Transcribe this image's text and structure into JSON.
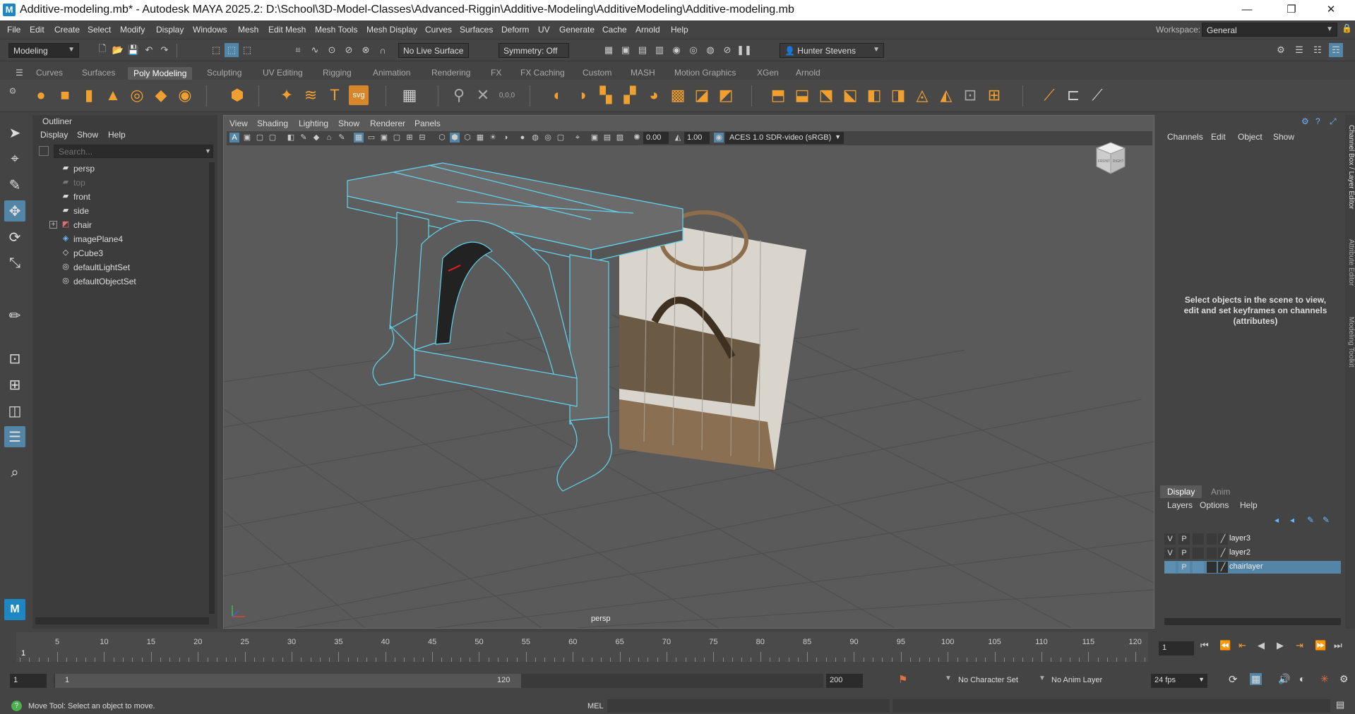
{
  "title": "Additive-modeling.mb* - Autodesk MAYA 2025.2: D:\\School\\3D-Model-Classes\\Advanced-Riggin\\Additive-Modeling\\AdditiveModeling\\Additive-modeling.mb",
  "window_controls": {
    "minimize": "—",
    "restore": "❐",
    "close": "✕"
  },
  "menubar": {
    "items": [
      "File",
      "Edit",
      "Create",
      "Select",
      "Modify",
      "Display",
      "Windows",
      "Mesh",
      "Edit Mesh",
      "Mesh Tools",
      "Mesh Display",
      "Curves",
      "Surfaces",
      "Deform",
      "UV",
      "Generate",
      "Cache",
      "Arnold",
      "Help"
    ],
    "workspace_label": "Workspace:",
    "workspace_value": "General"
  },
  "statusline": {
    "menuset": "Modeling",
    "live_surface": "No Live Surface",
    "symmetry": "Symmetry: Off",
    "user": "Hunter Stevens"
  },
  "shelf": {
    "tabs": [
      "Curves",
      "Surfaces",
      "Poly Modeling",
      "Sculpting",
      "UV Editing",
      "Rigging",
      "Animation",
      "Rendering",
      "FX",
      "FX Caching",
      "Custom",
      "MASH",
      "Motion Graphics",
      "XGen",
      "Arnold"
    ],
    "active_tab": "Poly Modeling",
    "text_icon": "T",
    "svg_icon": "svg",
    "xyz_icon": "0,0,0"
  },
  "outliner": {
    "title": "Outliner",
    "menu": [
      "Display",
      "Show",
      "Help"
    ],
    "search_placeholder": "Search...",
    "items": [
      {
        "label": "persp",
        "icon": "camera-icon"
      },
      {
        "label": "top",
        "icon": "camera-icon",
        "dimmed": true
      },
      {
        "label": "front",
        "icon": "camera-icon"
      },
      {
        "label": "side",
        "icon": "camera-icon"
      },
      {
        "label": "chair",
        "icon": "group-icon"
      },
      {
        "label": "imagePlane4",
        "icon": "image-plane-icon"
      },
      {
        "label": "pCube3",
        "icon": "mesh-icon"
      },
      {
        "label": "defaultLightSet",
        "icon": "set-icon"
      },
      {
        "label": "defaultObjectSet",
        "icon": "set-icon"
      }
    ]
  },
  "viewport": {
    "menu": [
      "View",
      "Shading",
      "Lighting",
      "Show",
      "Renderer",
      "Panels"
    ],
    "exposure": "0.00",
    "gamma": "1.00",
    "colorspace": "ACES 1.0 SDR-video (sRGB)",
    "camera_label": "persp",
    "viewcube_front": "FRONT",
    "viewcube_right": "RIGHT"
  },
  "channelbox": {
    "menu": [
      "Channels",
      "Edit",
      "Object",
      "Show"
    ],
    "message": "Select objects in the scene to view, edit and set keyframes on channels (attributes)",
    "side_tabs": [
      "Channel Box / Layer Editor",
      "Attribute Editor",
      "Modeling Toolkit"
    ]
  },
  "layer_editor": {
    "tabs": [
      "Display",
      "Anim"
    ],
    "active_tab": "Display",
    "menu": [
      "Layers",
      "Options",
      "Help"
    ],
    "layers": [
      {
        "v": "V",
        "p": "P",
        "name": "layer3",
        "selected": false
      },
      {
        "v": "V",
        "p": "P",
        "name": "layer2",
        "selected": false
      },
      {
        "v": "",
        "p": "P",
        "name": "chairlayer",
        "selected": true
      }
    ]
  },
  "timeline": {
    "start_label": "1",
    "ticks": [
      "5",
      "10",
      "15",
      "20",
      "25",
      "30",
      "35",
      "40",
      "45",
      "50",
      "55",
      "60",
      "65",
      "70",
      "75",
      "80",
      "85",
      "90",
      "95",
      "100",
      "105",
      "110",
      "115",
      "120"
    ],
    "current_frame": "1"
  },
  "range": {
    "start": "1",
    "inner_start": "1",
    "inner_end": "120",
    "end": "200",
    "character_set": "No Character Set",
    "anim_layer": "No Anim Layer",
    "fps": "24 fps"
  },
  "command_line": {
    "help_text": "Move Tool: Select an object to move.",
    "lang": "MEL"
  }
}
